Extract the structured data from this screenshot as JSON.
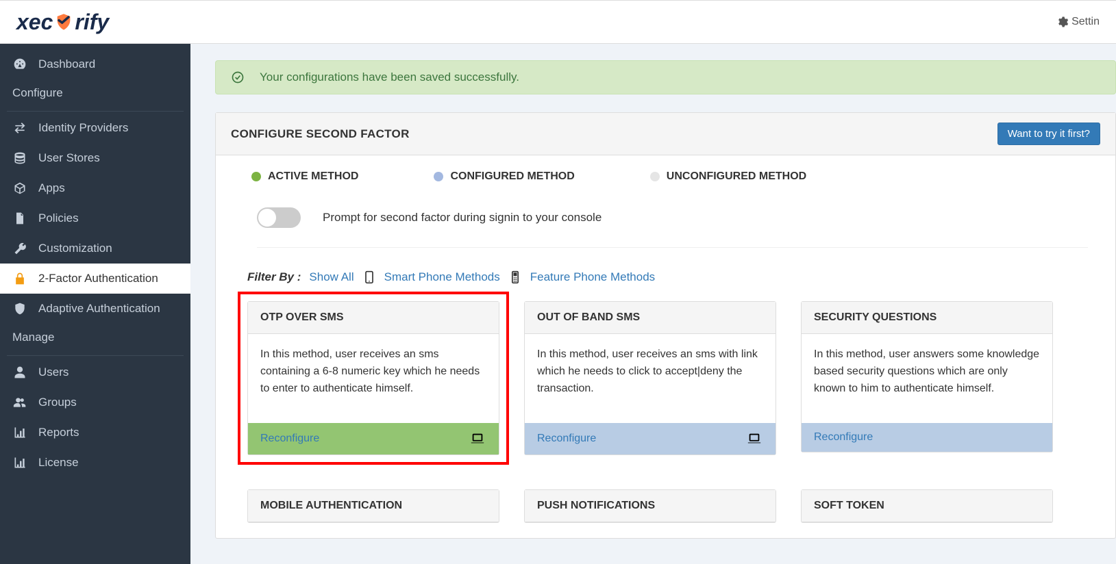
{
  "colors": {
    "active": "#7cb342",
    "configured": "#a3b8e0",
    "unconfigured": "#e5e5e5"
  },
  "topbar": {
    "logo_part1": "xec",
    "logo_part2": "rify",
    "settings": "Settin"
  },
  "sidebar": {
    "items_top": [
      {
        "label": "Dashboard",
        "icon": "dashboard"
      }
    ],
    "section_configure": "Configure",
    "items_configure": [
      {
        "label": "Identity Providers",
        "icon": "exchange"
      },
      {
        "label": "User Stores",
        "icon": "database"
      },
      {
        "label": "Apps",
        "icon": "cube"
      },
      {
        "label": "Policies",
        "icon": "file"
      },
      {
        "label": "Customization",
        "icon": "wrench"
      },
      {
        "label": "2-Factor Authentication",
        "icon": "lock",
        "active": true
      },
      {
        "label": "Adaptive Authentication",
        "icon": "shield"
      }
    ],
    "section_manage": "Manage",
    "items_manage": [
      {
        "label": "Users",
        "icon": "user"
      },
      {
        "label": "Groups",
        "icon": "users"
      },
      {
        "label": "Reports",
        "icon": "chart"
      },
      {
        "label": "License",
        "icon": "chart"
      }
    ]
  },
  "alert": {
    "text": "Your configurations have been saved successfully."
  },
  "panel": {
    "title": "CONFIGURE SECOND FACTOR",
    "try_button": "Want to try it first?"
  },
  "legend": {
    "active": "ACTIVE METHOD",
    "configured": "CONFIGURED METHOD",
    "unconfigured": "UNCONFIGURED METHOD"
  },
  "toggle": {
    "label": "Prompt for second factor during signin to your console"
  },
  "filter": {
    "label": "Filter By :",
    "show_all": "Show All",
    "smart": "Smart Phone Methods",
    "feature": "Feature Phone Methods"
  },
  "cards": [
    {
      "title": "OTP OVER SMS",
      "desc": "In this method, user receives an sms containing a 6-8 numeric key which he needs to enter to authenticate himself.",
      "action": "Reconfigure",
      "status": "active",
      "highlighted": true
    },
    {
      "title": "OUT OF BAND SMS",
      "desc": "In this method, user receives an sms with link which he needs to click to accept|deny the transaction.",
      "action": "Reconfigure",
      "status": "configured"
    },
    {
      "title": "SECURITY QUESTIONS",
      "desc": "In this method, user answers some knowledge based security questions which are only known to him to authenticate himself.",
      "action": "Reconfigure",
      "status": "configured"
    }
  ],
  "cards_row2": [
    {
      "title": "MOBILE AUTHENTICATION"
    },
    {
      "title": "PUSH NOTIFICATIONS"
    },
    {
      "title": "SOFT TOKEN"
    }
  ]
}
